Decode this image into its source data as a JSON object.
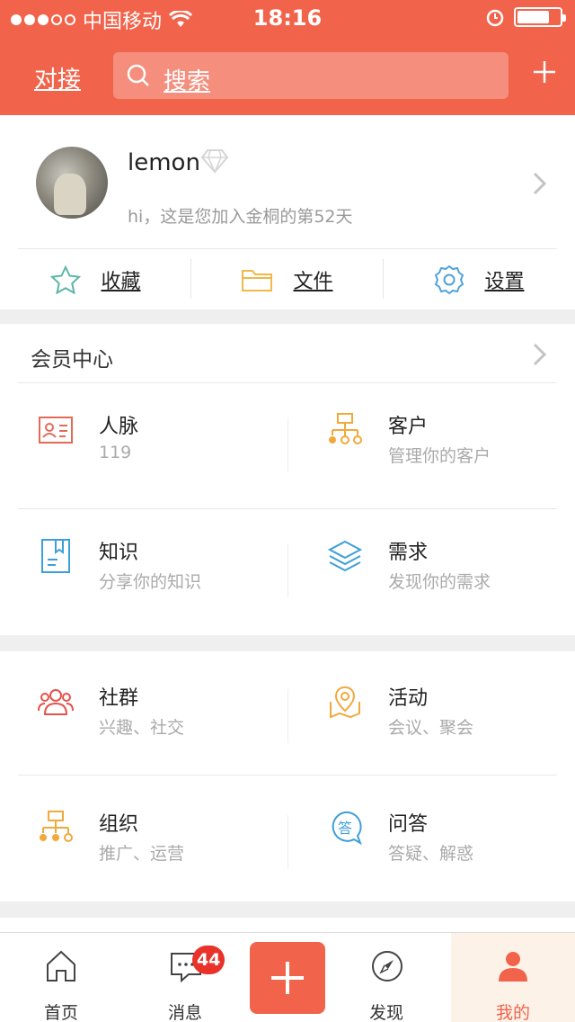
{
  "status_bar": {
    "carrier": "中国移动",
    "time": "18:16",
    "battery_level": 0.75
  },
  "header": {
    "left_link": "对接",
    "search_placeholder": "搜索",
    "accent_color": "#f2634b"
  },
  "profile": {
    "username": "lemon",
    "greeting": "hi，这是您加入金桐的第52天",
    "quick_actions": [
      {
        "label": "收藏",
        "icon": "star-icon"
      },
      {
        "label": "文件",
        "icon": "folder-icon"
      },
      {
        "label": "设置",
        "icon": "gear-icon"
      }
    ]
  },
  "member_center": {
    "title": "会员中心",
    "items": [
      {
        "title": "人脉",
        "subtitle": "119",
        "icon": "contact-card-icon"
      },
      {
        "title": "客户",
        "subtitle": "管理你的客户",
        "icon": "org-chart-icon"
      },
      {
        "title": "知识",
        "subtitle": "分享你的知识",
        "icon": "book-icon"
      },
      {
        "title": "需求",
        "subtitle": "发现你的需求",
        "icon": "layers-icon"
      }
    ]
  },
  "community": {
    "items": [
      {
        "title": "社群",
        "subtitle": "兴趣、社交",
        "icon": "group-icon"
      },
      {
        "title": "活动",
        "subtitle": "会议、聚会",
        "icon": "map-pin-icon"
      },
      {
        "title": "组织",
        "subtitle": "推广、运营",
        "icon": "org-chart-icon"
      },
      {
        "title": "问答",
        "subtitle": "答疑、解惑",
        "icon": "qa-bubble-icon",
        "icon_text": "答"
      }
    ]
  },
  "tabbar": {
    "tabs": [
      {
        "label": "首页",
        "icon": "home-icon"
      },
      {
        "label": "消息",
        "icon": "message-icon",
        "badge": "44"
      },
      {
        "label": "",
        "icon": "add-icon"
      },
      {
        "label": "发现",
        "icon": "compass-icon"
      },
      {
        "label": "我的",
        "icon": "person-icon",
        "active": true
      }
    ]
  }
}
